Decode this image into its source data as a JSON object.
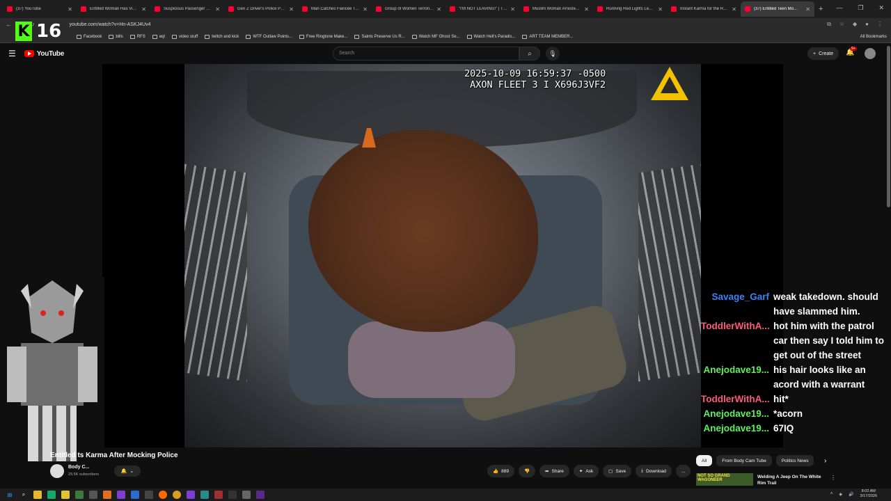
{
  "browser": {
    "tabs": [
      {
        "title": "(37) YouTube",
        "active": false
      },
      {
        "title": "Entitled Woman Has Violent...",
        "active": false
      },
      {
        "title": "Suspicious Passenger has...",
        "active": false
      },
      {
        "title": "Gen Z Driver's Police Pursuit",
        "active": false
      },
      {
        "title": "Man Catches Fiancée Texting",
        "active": false
      },
      {
        "title": "Group of Women Terrorize...",
        "active": false
      },
      {
        "title": "\"I'M NOT LEAVING!\" | This...",
        "active": false
      },
      {
        "title": "Muslim Woman Arrested A...",
        "active": false
      },
      {
        "title": "Running Red Lights Leads...",
        "active": false
      },
      {
        "title": "Instant Karma for the Rude...",
        "active": false
      },
      {
        "title": "(37) Entitled Teen Mo...",
        "active": true
      }
    ],
    "new_tab": "+",
    "url": "youtube.com/watch?v=Hn-ASKJ4Uv4",
    "bookmarks": [
      "Facebook",
      "bills",
      "RFS",
      "eqI",
      "video stuff",
      "twitch and kick",
      "WTF Outlaw Points...",
      "Free Ringtone Make...",
      "Saints Preserve Us R...",
      "Watch MF Ghost Se...",
      "Watch Hell's Paradis...",
      "ART TEAM MEMBER..."
    ],
    "all_bookmarks": "All Bookmarks"
  },
  "overlay": {
    "k_logo": "K",
    "k_count": "16"
  },
  "youtube": {
    "logo_text": "YouTube",
    "search_placeholder": "Search",
    "create_label": "Create",
    "notif_badge": "9+"
  },
  "video": {
    "timestamp": "2025-10-09 16:59:37 -0500",
    "camera_id": "AXON FLEET 3 I X696J3VF2"
  },
  "chat": [
    {
      "user": "Savage_Garf",
      "color": "#3a82f6",
      "lines": [
        "weak takedown. should",
        "have slammed him."
      ]
    },
    {
      "user": "ToddlerWithA...",
      "color": "#ff5a7a",
      "lines": [
        "hot him with the patrol",
        "car then say I told him to",
        "get out of the street"
      ]
    },
    {
      "user": "Anejodave19...",
      "color": "#5cf25c",
      "lines": [
        "his hair looks like an",
        "acord with a warrant"
      ]
    },
    {
      "user": "ToddlerWithA...",
      "color": "#ff5a7a",
      "lines": [
        "hit*"
      ]
    },
    {
      "user": "Anejodave19...",
      "color": "#5cf25c",
      "lines": [
        "*acorn"
      ]
    },
    {
      "user": "Anejodave19...",
      "color": "#5cf25c",
      "lines": [
        "67IQ"
      ]
    }
  ],
  "below": {
    "title_partial": "Entitled           ts Karma After Mocking Police",
    "channel_name": "Body C...",
    "channel_subs": "29.5K subscribers",
    "like_count": "889",
    "share_label": "Share",
    "ask_label": "Ask",
    "save_label": "Save",
    "download_label": "Download",
    "more_label": "..."
  },
  "recommend": {
    "chips": [
      "All",
      "From Body Cam Tube",
      "Politics News"
    ],
    "thumb_text": "NOT SO GRAND WAGONEER",
    "video_title": "Welding A Jeep On The White Rim Trail"
  },
  "taskbar": {
    "time": "8:02 AM",
    "date": "3/17/2026"
  }
}
